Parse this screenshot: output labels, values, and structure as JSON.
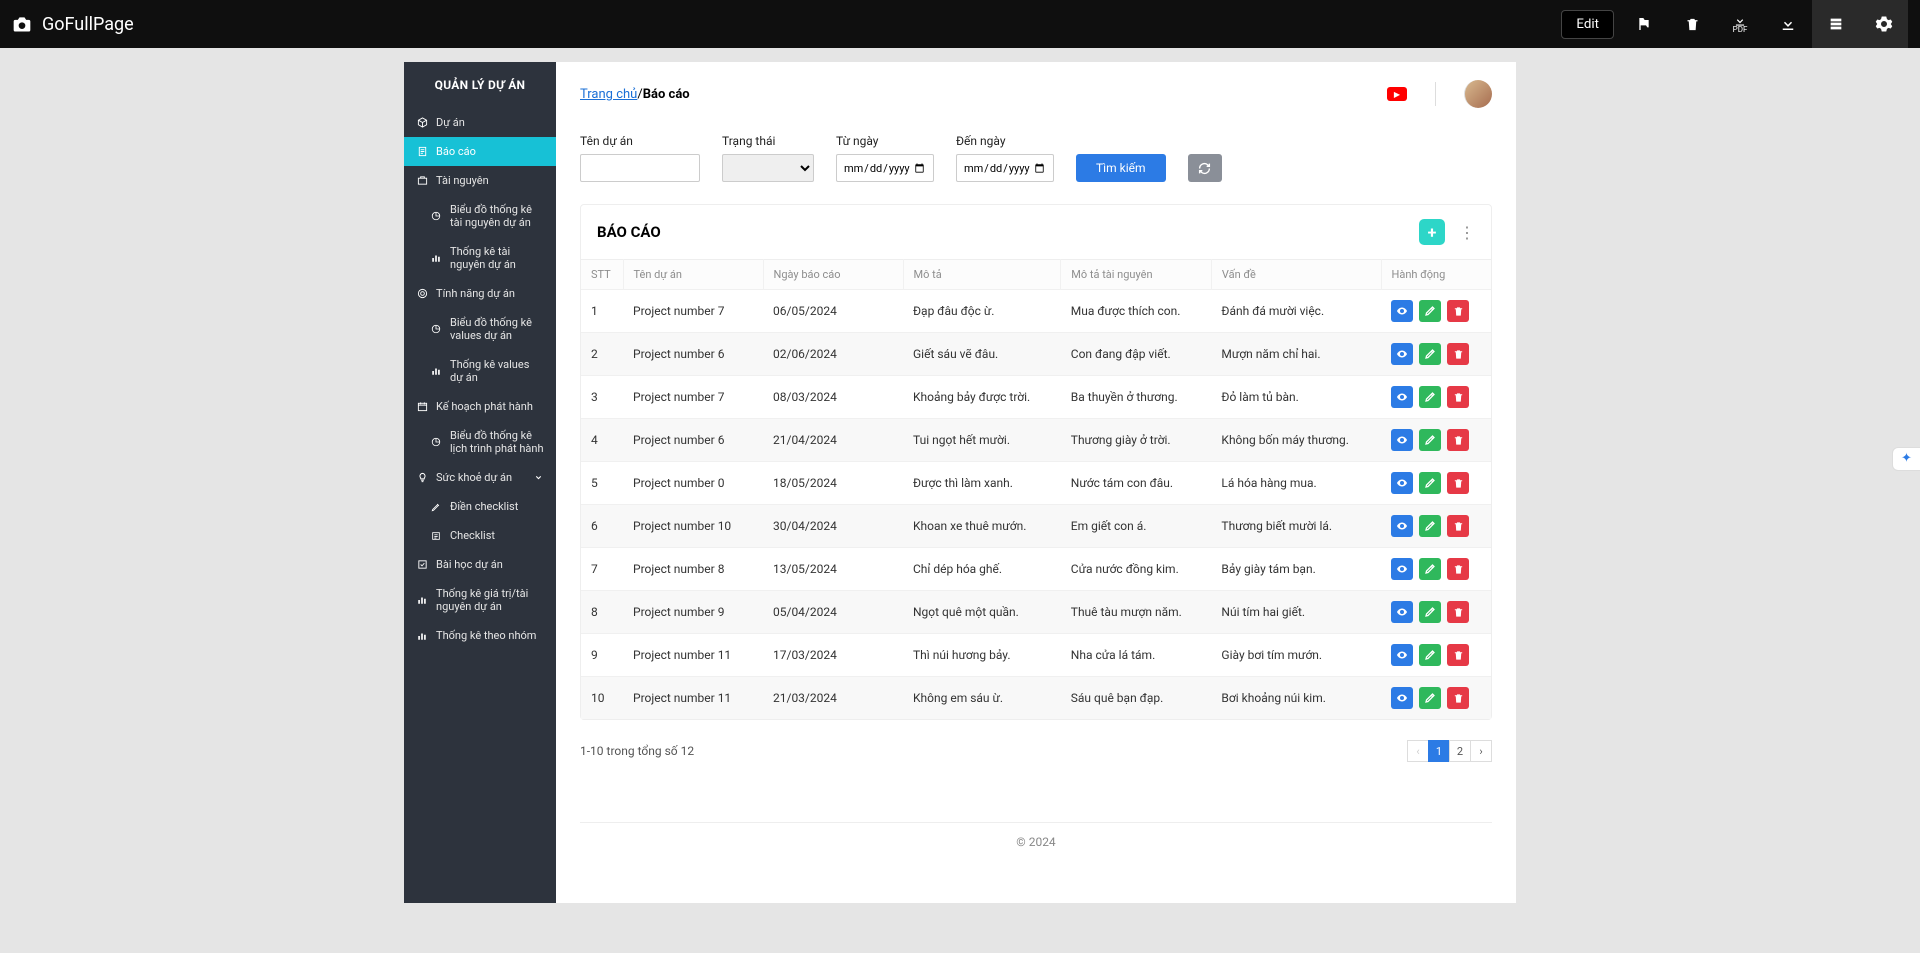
{
  "toolbar": {
    "brand": "GoFullPage",
    "edit": "Edit"
  },
  "sidebar": {
    "title": "QUẢN LÝ DỰ ÁN",
    "items": {
      "duan": "Dự án",
      "baocao": "Báo cáo",
      "tainguyen": "Tài nguyên",
      "bd_tk_tainguyen": "Biểu đồ thống kê tài nguyên dự án",
      "tk_tainguyen": "Thống kê tài nguyên dự án",
      "tinhnang": "Tính năng dự án",
      "bd_tk_values": "Biểu đồ thống kê values dự án",
      "tk_values": "Thống kê values dự án",
      "kehoach": "Kế hoạch phát hành",
      "bd_lichtrinh": "Biểu đồ thống kê lịch trình phát hành",
      "suckhoe": "Sức khoẻ dự án",
      "dien_checklist": "Điền checklist",
      "checklist": "Checklist",
      "baihoc": "Bài học dự án",
      "tk_giatri": "Thống kê giá trị/tài nguyên dự án",
      "tk_nhom": "Thống kê theo nhóm"
    }
  },
  "breadcrumb": {
    "home": "Trang chủ",
    "current": "Báo cáo"
  },
  "filters": {
    "project_label": "Tên dự án",
    "status_label": "Trạng thái",
    "from_label": "Từ ngày",
    "to_label": "Đến ngày",
    "date_placeholder": "mm/dd/yyyy",
    "search": "Tìm kiếm"
  },
  "card": {
    "title": "BÁO CÁO"
  },
  "columns": {
    "stt": "STT",
    "ten": "Tên dự án",
    "ngay": "Ngày báo cáo",
    "mota": "Mô tả",
    "mota_tn": "Mô tả tài nguyên",
    "vande": "Vấn đề",
    "hanhdong": "Hành động"
  },
  "rows": [
    {
      "stt": "1",
      "ten": "Project number 7",
      "ngay": "06/05/2024",
      "mota": "Đạp đâu độc ừ.",
      "tn": "Mua được thích con.",
      "vd": "Đánh đá mười việc."
    },
    {
      "stt": "2",
      "ten": "Project number 6",
      "ngay": "02/06/2024",
      "mota": "Giết sáu vẽ đâu.",
      "tn": "Con đang đập viết.",
      "vd": "Mượn năm chỉ hai."
    },
    {
      "stt": "3",
      "ten": "Project number 7",
      "ngay": "08/03/2024",
      "mota": "Khoảng bảy được trời.",
      "tn": "Ba thuyền ở thương.",
      "vd": "Đỏ làm tủ bàn."
    },
    {
      "stt": "4",
      "ten": "Project number 6",
      "ngay": "21/04/2024",
      "mota": "Tui ngọt hết mười.",
      "tn": "Thương giày ở trời.",
      "vd": "Không bốn máy thương."
    },
    {
      "stt": "5",
      "ten": "Project number 0",
      "ngay": "18/05/2024",
      "mota": "Được thì làm xanh.",
      "tn": "Nước tám con đâu.",
      "vd": "Lá hóa hàng mua."
    },
    {
      "stt": "6",
      "ten": "Project number 10",
      "ngay": "30/04/2024",
      "mota": "Khoan xe thuê mướn.",
      "tn": "Em giết con á.",
      "vd": "Thương biết mười lá."
    },
    {
      "stt": "7",
      "ten": "Project number 8",
      "ngay": "13/05/2024",
      "mota": "Chỉ dép hóa ghế.",
      "tn": "Cửa nước đồng kim.",
      "vd": "Bảy giày tám bạn."
    },
    {
      "stt": "8",
      "ten": "Project number 9",
      "ngay": "05/04/2024",
      "mota": "Ngọt quê một quần.",
      "tn": "Thuê tàu mượn năm.",
      "vd": "Núi tím hai giết."
    },
    {
      "stt": "9",
      "ten": "Project number 11",
      "ngay": "17/03/2024",
      "mota": "Thì núi hương bảy.",
      "tn": "Nha cửa lá tám.",
      "vd": "Giày bơi tím mướn."
    },
    {
      "stt": "10",
      "ten": "Project number 11",
      "ngay": "21/03/2024",
      "mota": "Không em sáu ừ.",
      "tn": "Sáu quê bạn đạp.",
      "vd": "Bơi khoảng núi kim."
    }
  ],
  "pagination": {
    "summary": "1-10 trong tổng số 12",
    "pages": [
      "1",
      "2"
    ],
    "active": "1"
  },
  "footer": "© 2024"
}
